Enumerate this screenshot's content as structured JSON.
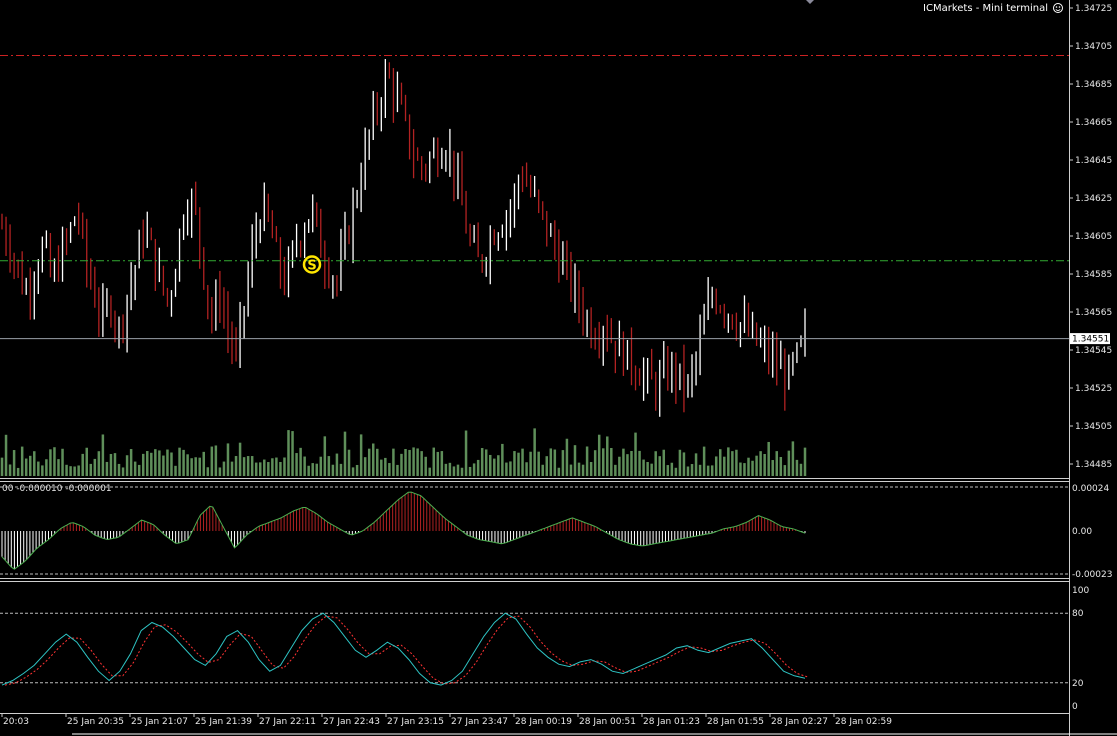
{
  "window": {
    "title": "ICMarkets - Mini terminal",
    "smiley_icon": "smiley-icon"
  },
  "signal_marker": {
    "label": "S",
    "price": 1.3459
  },
  "current_price_label": "1.34551",
  "colors": {
    "background": "#000000",
    "bull_candle": "#ffffff",
    "bear_candle": "#b22222",
    "volume": "#5f8f5a",
    "resistance_line": "#cc2222",
    "support_line": "#33aa33",
    "current_price_line": "#9aa0a8",
    "osc_pos": "#b22222",
    "osc_neg": "#ffffff",
    "stoch_main": "#2ec4c4",
    "stoch_signal": "#ff3333"
  },
  "chart_data": [
    {
      "type": "candlestick",
      "panel": "price",
      "ylim": [
        1.3444,
        1.3473
      ],
      "y_ticks": [
        "1.34725",
        "1.34705",
        "1.34685",
        "1.34665",
        "1.34645",
        "1.34625",
        "1.34605",
        "1.34585",
        "1.34565",
        "1.34545",
        "1.34525",
        "1.34505",
        "1.34485"
      ],
      "x_ticks": [
        "20:03",
        "25 Jan 20:35",
        "25 Jan 21:07",
        "25 Jan 21:39",
        "27 Jan 22:11",
        "27 Jan 22:43",
        "27 Jan 23:15",
        "27 Jan 23:47",
        "28 Jan 00:19",
        "28 Jan 00:51",
        "28 Jan 01:23",
        "28 Jan 01:55",
        "28 Jan 02:27",
        "28 Jan 02:59"
      ],
      "resistance_level": 1.347,
      "support_level": 1.34592,
      "current_price": 1.34551,
      "close_path": [
        1.3461,
        1.346,
        1.34585,
        1.34575,
        1.3459,
        1.346,
        1.3458,
        1.34595,
        1.34605,
        1.3462,
        1.3459,
        1.34575,
        1.3456,
        1.3457,
        1.34555,
        1.34575,
        1.3459,
        1.3461,
        1.34595,
        1.3458,
        1.3457,
        1.346,
        1.34625,
        1.3462,
        1.3459,
        1.3456,
        1.34575,
        1.34555,
        1.3454,
        1.3457,
        1.346,
        1.3462,
        1.3461,
        1.3459,
        1.3458,
        1.346,
        1.3461,
        1.3462,
        1.346,
        1.3459,
        1.3458,
        1.346,
        1.3462,
        1.3464,
        1.3466,
        1.34675,
        1.3469,
        1.3468,
        1.34665,
        1.3465,
        1.3464,
        1.34645,
        1.3465,
        1.34655,
        1.3464,
        1.3462,
        1.346,
        1.3459,
        1.346,
        1.3461,
        1.34615,
        1.3462,
        1.3464,
        1.3463,
        1.3462,
        1.3461,
        1.346,
        1.3459,
        1.3458,
        1.3457,
        1.3456,
        1.34555,
        1.3456,
        1.3455,
        1.34545,
        1.3454,
        1.34535,
        1.3453,
        1.34525,
        1.3453,
        1.34535,
        1.3453,
        1.34525,
        1.3454,
        1.3456,
        1.34575,
        1.3457,
        1.34565,
        1.3456,
        1.34555,
        1.3455,
        1.34545,
        1.3454,
        1.34535,
        1.3453,
        1.3454,
        1.34551
      ]
    },
    {
      "type": "bar",
      "panel": "volume",
      "note_values": "relative tick volume 0..1",
      "count": 200
    },
    {
      "type": "histogram",
      "panel": "oscillator",
      "header": "00 -0.000010 -0.000001",
      "ylim": [
        -0.00023,
        0.00024
      ],
      "y_ticks": [
        "0.00024",
        "0.00",
        "-0.00023"
      ],
      "values_rel": [
        -0.6,
        -0.9,
        -0.7,
        -0.4,
        -0.2,
        0.05,
        0.2,
        0.1,
        -0.1,
        -0.2,
        -0.15,
        0.05,
        0.25,
        0.15,
        -0.1,
        -0.3,
        -0.2,
        0.35,
        0.6,
        0.1,
        -0.4,
        -0.1,
        0.1,
        0.2,
        0.3,
        0.45,
        0.55,
        0.4,
        0.2,
        0.05,
        -0.1,
        0.0,
        0.2,
        0.45,
        0.7,
        0.9,
        0.8,
        0.55,
        0.3,
        0.1,
        -0.1,
        -0.2,
        -0.25,
        -0.3,
        -0.2,
        -0.1,
        0.0,
        0.1,
        0.2,
        0.3,
        0.2,
        0.1,
        -0.05,
        -0.2,
        -0.3,
        -0.35,
        -0.3,
        -0.25,
        -0.2,
        -0.15,
        -0.1,
        -0.05,
        0.05,
        0.1,
        0.2,
        0.35,
        0.25,
        0.1,
        0.05,
        -0.05
      ]
    },
    {
      "type": "line",
      "panel": "stochastic",
      "ylim": [
        0,
        100
      ],
      "y_ticks": [
        "100",
        "80",
        "20",
        "0"
      ],
      "levels": [
        80,
        20
      ],
      "main_values": [
        18,
        22,
        28,
        35,
        45,
        55,
        62,
        55,
        42,
        30,
        22,
        30,
        45,
        65,
        72,
        68,
        60,
        50,
        40,
        35,
        45,
        60,
        65,
        55,
        40,
        30,
        35,
        50,
        65,
        75,
        80,
        72,
        60,
        48,
        42,
        48,
        55,
        50,
        40,
        28,
        20,
        18,
        22,
        30,
        45,
        60,
        72,
        80,
        75,
        62,
        50,
        42,
        36,
        34,
        38,
        40,
        36,
        30,
        28,
        32,
        36,
        40,
        44,
        50,
        52,
        48,
        46,
        50,
        54,
        56,
        58,
        50,
        40,
        30,
        26,
        24
      ]
    }
  ]
}
